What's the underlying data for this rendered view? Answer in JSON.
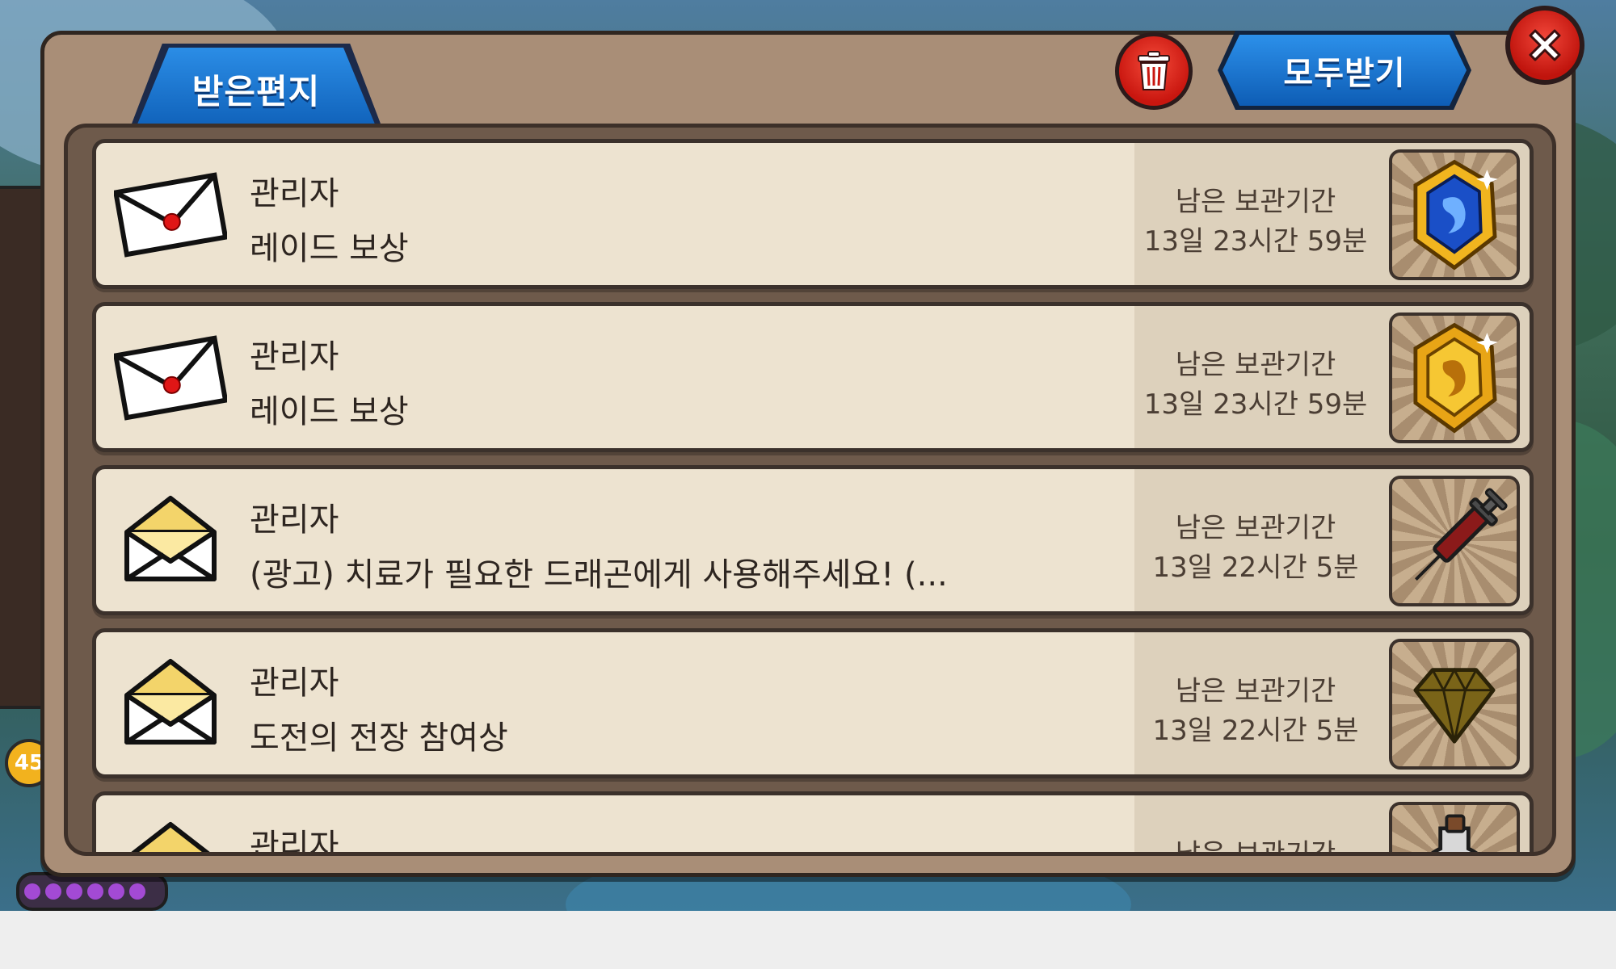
{
  "window": {
    "tab_label": "받은편지",
    "receive_all_label": "모두받기",
    "delete_icon": "trash-icon",
    "close_icon": "close-icon"
  },
  "background": {
    "left_badge": "45"
  },
  "mails": [
    {
      "sender": "관리자",
      "subject": "레이드 보상",
      "remain_label": "남은 보관기간",
      "remain_time": "13일 23시간 59분",
      "envelope": "sealed-envelope-icon",
      "item": "blue-dragon-medal-icon"
    },
    {
      "sender": "관리자",
      "subject": "레이드 보상",
      "remain_label": "남은 보관기간",
      "remain_time": "13일 23시간 59분",
      "envelope": "sealed-envelope-icon",
      "item": "gold-dragon-medal-icon"
    },
    {
      "sender": "관리자",
      "subject": "(광고) 치료가 필요한 드래곤에게 사용해주세요! (...",
      "remain_label": "남은 보관기간",
      "remain_time": "13일 22시간 5분",
      "envelope": "open-envelope-icon",
      "item": "syringe-icon"
    },
    {
      "sender": "관리자",
      "subject": "도전의 전장 참여상",
      "remain_label": "남은 보관기간",
      "remain_time": "13일 22시간 5분",
      "envelope": "open-envelope-icon",
      "item": "gem-icon"
    },
    {
      "sender": "관리자",
      "subject": "",
      "remain_label": "남은 보관기간",
      "remain_time": "",
      "envelope": "open-envelope-icon",
      "item": "potion-icon"
    }
  ],
  "colors": {
    "frame": "#a98e77",
    "list_bg": "#6e5a4b",
    "item_bg": "#ede3d0",
    "blue_button": "#1a72cf",
    "red_button": "#d9211a"
  }
}
